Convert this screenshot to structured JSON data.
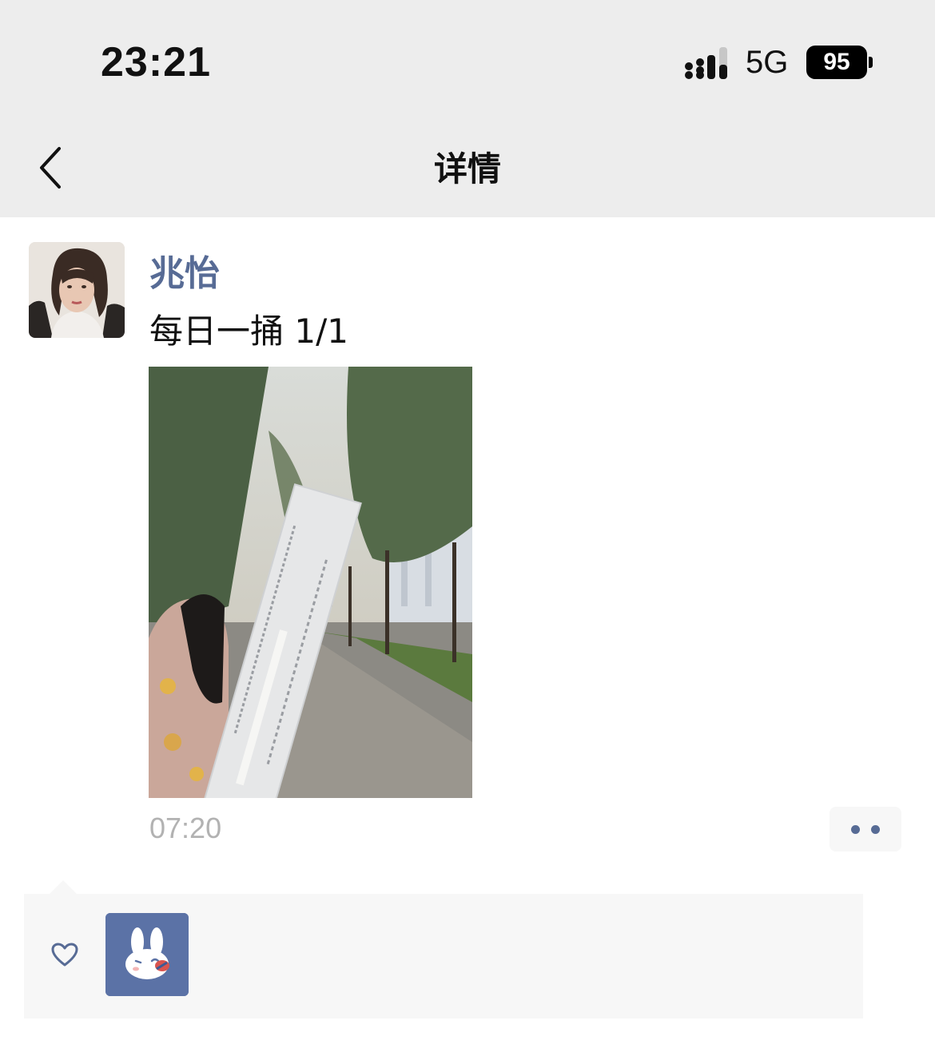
{
  "status_bar": {
    "time": "23:21",
    "network": "5G",
    "battery": "95",
    "icons": [
      "signal-icon",
      "battery-icon"
    ]
  },
  "nav": {
    "title": "详情",
    "back_icon": "chevron-left-icon"
  },
  "post": {
    "author": "兆怡",
    "text": "每日一捅 1/1",
    "time": "07:20",
    "more_icon": "more-dots-icon"
  },
  "likes": {
    "icon": "heart-icon",
    "liker_avatar": "bunny-avatar"
  },
  "colors": {
    "link_blue": "#576b95",
    "bar_bg": "#ededed",
    "panel_bg": "#f7f7f7",
    "time_gray": "#b2b2b2"
  }
}
